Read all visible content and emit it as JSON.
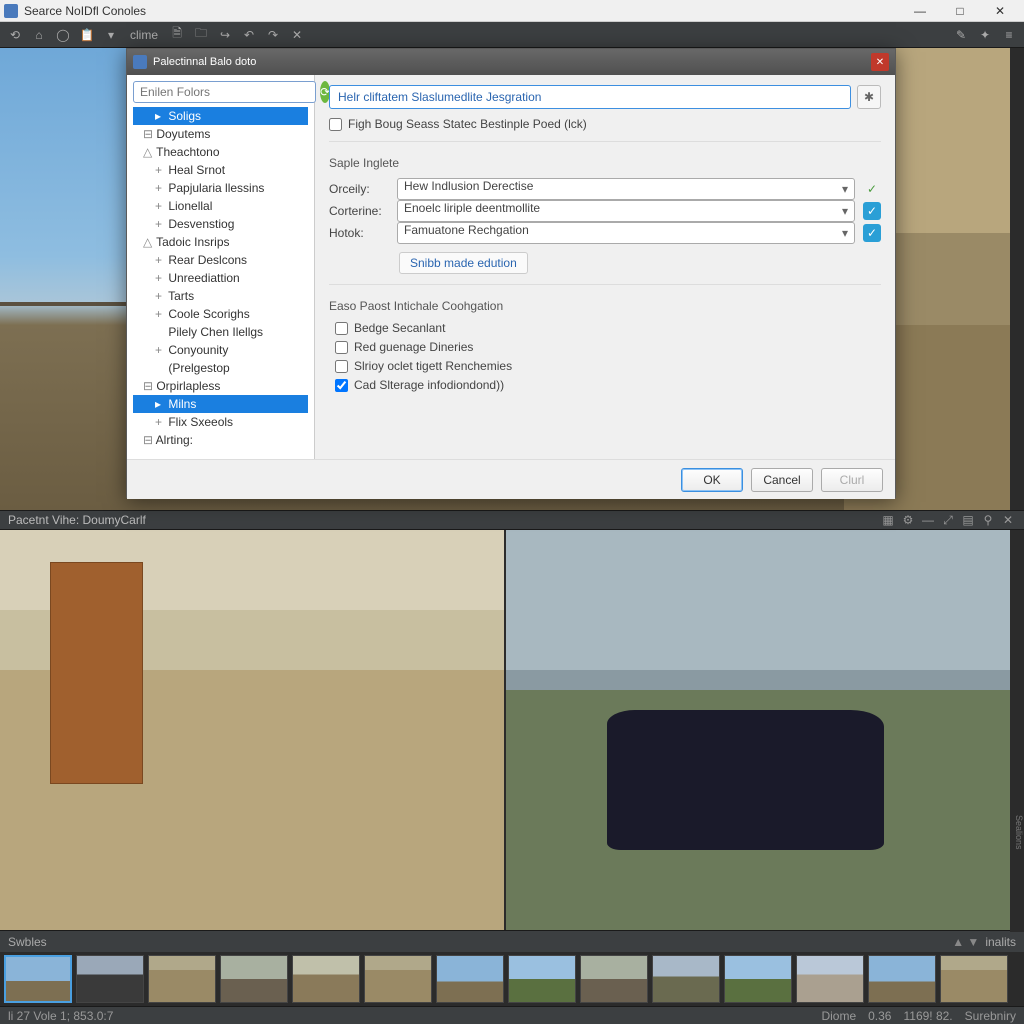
{
  "window": {
    "title": "Searce NoIDfl Conoles",
    "min": "—",
    "max": "□",
    "close": "✕"
  },
  "toolbar": {
    "menu_label": "clime"
  },
  "dialog": {
    "title": "Palectinnal Balo doto",
    "search_placeholder": "Enilen Folors",
    "tree": [
      {
        "label": "Soligs",
        "depth": 1,
        "sel": true,
        "arrow": true
      },
      {
        "label": "Doyutems",
        "depth": 0,
        "exp": "⊟"
      },
      {
        "label": "Theachtono",
        "depth": 0,
        "exp": "△"
      },
      {
        "label": "Heal Srnot",
        "depth": 1,
        "plus": true
      },
      {
        "label": "Papjularia llessins",
        "depth": 1,
        "plus": true
      },
      {
        "label": "Lionellal",
        "depth": 1,
        "plus": true
      },
      {
        "label": "Desvenstiog",
        "depth": 1,
        "plus": true
      },
      {
        "label": "Tadoic Insrips",
        "depth": 0,
        "exp": "△"
      },
      {
        "label": "Rear Deslcons",
        "depth": 1,
        "plus": true
      },
      {
        "label": "Unreediattion",
        "depth": 1,
        "plus": true
      },
      {
        "label": "Tarts",
        "depth": 1,
        "plus": true
      },
      {
        "label": "Coole Scorighs",
        "depth": 1,
        "plus": true
      },
      {
        "label": "Pilely Chen Ilellgs",
        "depth": 1
      },
      {
        "label": "Conyounity",
        "depth": 1,
        "plus": true
      },
      {
        "label": "(Prelgestop",
        "depth": 1
      },
      {
        "label": "Orpirlapless",
        "depth": 0,
        "exp": "⊟"
      },
      {
        "label": "Milns",
        "depth": 1,
        "sel": true,
        "arrow": true
      },
      {
        "label": "Flix Sxeeols",
        "depth": 1,
        "plus": true
      },
      {
        "label": "Alrting:",
        "depth": 0,
        "exp": "⊟"
      }
    ],
    "main_field": "Helr cliftatem Slaslumedlite Jesgration",
    "top_checkbox": "Figh Boug Seass Statec Bestinple Poed (lck)",
    "section1": "Saple Inglete",
    "rows": [
      {
        "label": "Orceily:",
        "value": "Hew Indlusion Derectise",
        "side": "check"
      },
      {
        "label": "Corterine:",
        "value": "Enoelc liriple deentmollite",
        "side": "bluecheck"
      },
      {
        "label": "Hotok:",
        "value": "Famuatone Rechgation",
        "side": "bluecheck"
      }
    ],
    "link_button": "Snibb made edution",
    "section2": "Easo Paost Intichale Coohgation",
    "checks": [
      {
        "label": "Bedge Secanlant",
        "checked": false
      },
      {
        "label": "Red guenage Dineries",
        "checked": false
      },
      {
        "label": "Slrioy oclet tigett Renchemies",
        "checked": false
      },
      {
        "label": "Cad Slterage infodiondond))",
        "checked": true
      }
    ],
    "buttons": {
      "ok": "OK",
      "cancel": "Cancel",
      "help": "Clurl"
    }
  },
  "panel": {
    "title": "Pacetnt Vihe: DoumyCarlf"
  },
  "thumbbar": {
    "left": "Swbles",
    "mid": "▲  ▼",
    "right": "inalits"
  },
  "status": {
    "left": "li 27 Vole 1; 853.0:7",
    "r1": "Diome",
    "r2": "0.36",
    "r3": "1169! 82.",
    "r4": "Surebniry"
  },
  "rightstrip": "Sealions"
}
